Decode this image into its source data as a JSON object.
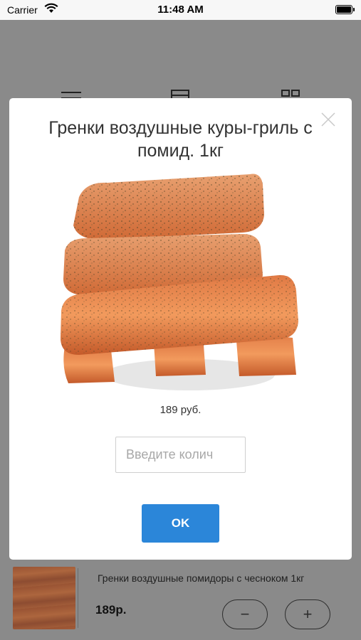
{
  "status_bar": {
    "carrier": "Carrier",
    "time": "11:48 AM"
  },
  "toolbar": {
    "icons": [
      "menu-icon",
      "cart-icon",
      "grid-icon"
    ]
  },
  "dialog": {
    "title": "Гренки воздушные куры-гриль с помид. 1кг",
    "price": "189 руб.",
    "quantity_placeholder": "Введите колич",
    "quantity_value": "",
    "ok_label": "OK",
    "close_icon": "close-icon"
  },
  "background_item": {
    "name": "Гренки воздушные помидоры с чесноком 1кг",
    "price": "189р.",
    "minus_label": "−",
    "plus_label": "+"
  },
  "colors": {
    "overlay": "#8a8a8a",
    "accent": "#2b86d9",
    "modal_bg": "#ffffff"
  }
}
